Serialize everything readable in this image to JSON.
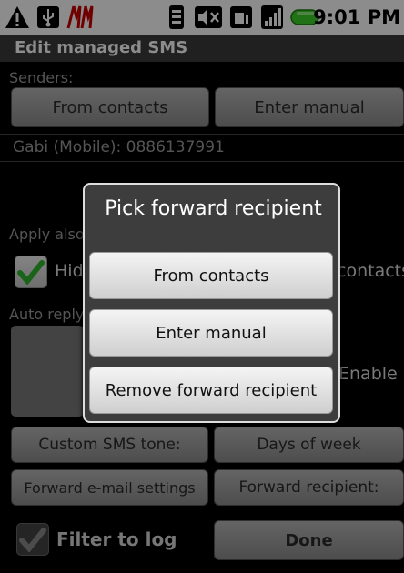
{
  "status_bar": {
    "time": "9:01 PM",
    "icons": [
      "warning-icon",
      "usb-icon",
      "app-icon",
      "vibrate-icon",
      "mute-icon",
      "sd-card-icon",
      "signal-icon",
      "battery-icon"
    ]
  },
  "screen": {
    "title": "Edit managed SMS",
    "senders_label": "Senders:",
    "from_contacts_label": "From contacts",
    "enter_manual_label": "Enter manual",
    "sender_entry": "Gabi (Mobile): 0886137991",
    "apply_also_label": "Apply also to:",
    "hide_checkbox_label": "Hide",
    "contacts_label": "contacts",
    "auto_reply_label": "Auto reply",
    "enable_label": "Enable",
    "custom_tone_label": "Custom SMS tone:",
    "days_of_week_label": "Days of week",
    "forward_email_label": "Forward e-mail settings",
    "forward_recipient_label": "Forward recipient:",
    "filter_to_log_label": "Filter to log",
    "done_label": "Done"
  },
  "dialog": {
    "title": "Pick forward recipient",
    "options": [
      "From contacts",
      "Enter manual",
      "Remove forward recipient"
    ]
  },
  "colors": {
    "checkmark": "#2fb62f",
    "battery": "#3ccf2a"
  }
}
